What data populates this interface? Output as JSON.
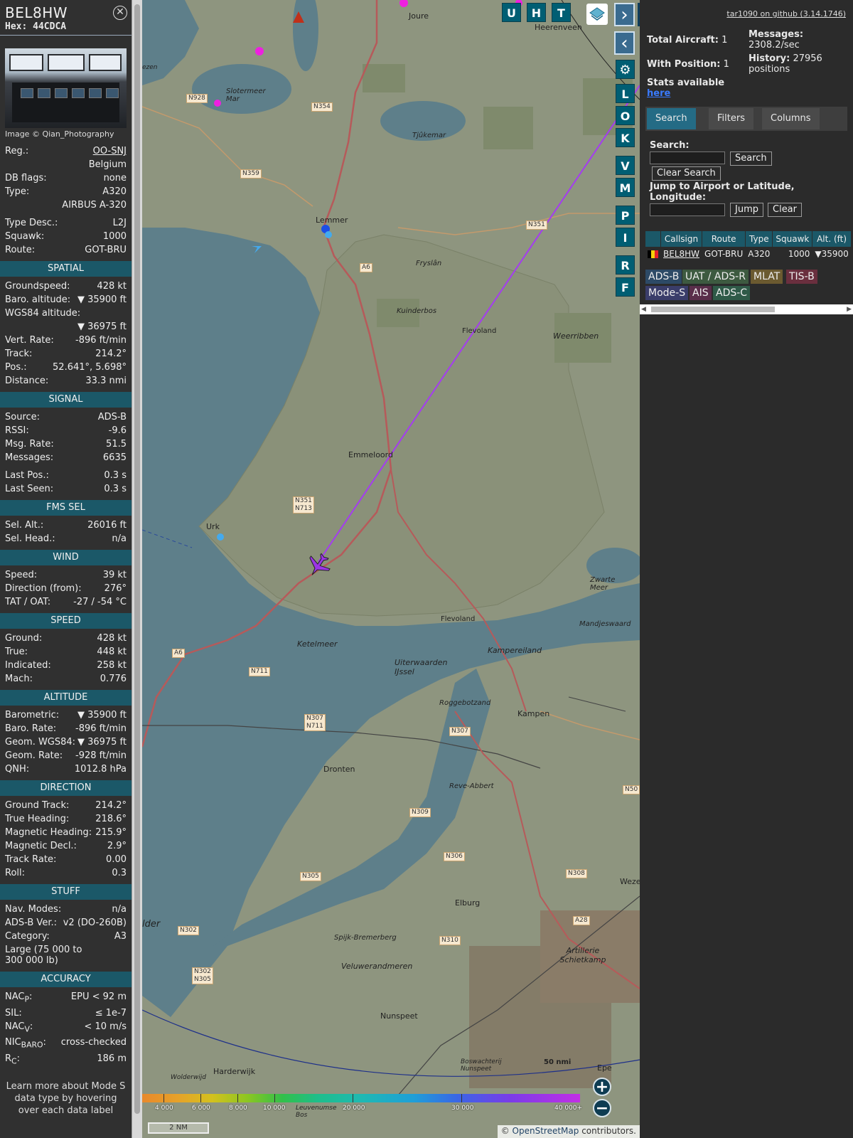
{
  "aircraft": {
    "callsign": "BEL8HW",
    "hex_label": "Hex:",
    "hex": "44CDCA",
    "image_credit": "Image © Qian_Photography",
    "reg_label": "Reg.:",
    "reg": "OO-SNJ",
    "country": "Belgium",
    "dbflags_label": "DB flags:",
    "dbflags": "none",
    "type_label": "Type:",
    "type": "A320",
    "type_full": "AIRBUS A-320",
    "typedesc_label": "Type Desc.:",
    "typedesc": "L2J",
    "squawk_label": "Squawk:",
    "squawk": "1000",
    "route_label": "Route:",
    "route": "GOT-BRU"
  },
  "spatial": {
    "title": "SPATIAL",
    "groundspeed_label": "Groundspeed:",
    "groundspeed": "428 kt",
    "baro_label": "Baro. altitude:",
    "baro": "▼ 35900 ft",
    "wgs_label": "WGS84 altitude:",
    "wgs": "▼ 36975 ft",
    "vrate_label": "Vert. Rate:",
    "vrate": "-896 ft/min",
    "track_label": "Track:",
    "track": "214.2°",
    "pos_label": "Pos.:",
    "pos": "52.641°, 5.698°",
    "dist_label": "Distance:",
    "dist": "33.3 nmi"
  },
  "signal": {
    "title": "SIGNAL",
    "source_label": "Source:",
    "source": "ADS-B",
    "rssi_label": "RSSI:",
    "rssi": "-9.6",
    "msgrate_label": "Msg. Rate:",
    "msgrate": "51.5",
    "messages_label": "Messages:",
    "messages": "6635",
    "lastpos_label": "Last Pos.:",
    "lastpos": "0.3 s",
    "lastseen_label": "Last Seen:",
    "lastseen": "0.3 s"
  },
  "fms": {
    "title": "FMS SEL",
    "selalt_label": "Sel. Alt.:",
    "selalt": "26016 ft",
    "selhead_label": "Sel. Head.:",
    "selhead": "n/a"
  },
  "wind": {
    "title": "WIND",
    "speed_label": "Speed:",
    "speed": "39 kt",
    "dir_label": "Direction (from):",
    "dir": "276°",
    "tat_label": "TAT / OAT:",
    "tat": "-27 / -54 °C"
  },
  "speed": {
    "title": "SPEED",
    "ground_label": "Ground:",
    "ground": "428 kt",
    "true_label": "True:",
    "true": "448 kt",
    "ind_label": "Indicated:",
    "ind": "258 kt",
    "mach_label": "Mach:",
    "mach": "0.776"
  },
  "altitude": {
    "title": "ALTITUDE",
    "baro_label": "Barometric:",
    "baro": "▼ 35900 ft",
    "bararate_label": "Baro. Rate:",
    "bararate": "-896 ft/min",
    "geom_label": "Geom. WGS84:",
    "geom": "▼ 36975 ft",
    "geomrate_label": "Geom. Rate:",
    "geomrate": "-928 ft/min",
    "qnh_label": "QNH:",
    "qnh": "1012.8 hPa"
  },
  "direction": {
    "title": "DIRECTION",
    "gtrack_label": "Ground Track:",
    "gtrack": "214.2°",
    "thead_label": "True Heading:",
    "thead": "218.6°",
    "mhead_label": "Magnetic Heading:",
    "mhead": "215.9°",
    "mdecl_label": "Magnetic Decl.:",
    "mdecl": "2.9°",
    "trate_label": "Track Rate:",
    "trate": "0.00",
    "roll_label": "Roll:",
    "roll": "0.3"
  },
  "stuff": {
    "title": "STUFF",
    "navmodes_label": "Nav. Modes:",
    "navmodes": "n/a",
    "adsbver_label": "ADS-B Ver.:",
    "adsbver": "v2 (DO-260B)",
    "category_label": "Category:",
    "category": "A3",
    "category_desc": "Large (75 000 to 300 000 lb)"
  },
  "accuracy": {
    "title": "ACCURACY",
    "nacp_label": "NAC",
    "nacp_sub": "P",
    "nacp": "EPU < 92 m",
    "sil_label": "SIL:",
    "sil": "≤ 1e-7",
    "nacv_label": "NAC",
    "nacv_sub": "V",
    "nacv": "< 10 m/s",
    "nicbaro_label": "NIC",
    "nicbaro_sub": "BARO",
    "nicbaro": "cross-checked",
    "rc_label": "R",
    "rc_sub": "C",
    "rc": "186 m"
  },
  "learn_more": "Learn more about Mode S data type by hovering over each data label",
  "map": {
    "buttons_top": [
      "U",
      "H",
      "T"
    ],
    "buttons_side": [
      "L",
      "O",
      "K",
      "V",
      "M",
      "P",
      "I",
      "R",
      "F"
    ],
    "color_scale": [
      "4 000",
      "6 000",
      "8 000",
      "10 000",
      "20 000",
      "30 000",
      "40 000+"
    ],
    "scale": "2 NM",
    "range_ring": "50 nmi",
    "attribution_prefix": "© ",
    "attribution_link": "OpenStreetMap",
    "attribution_suffix": " contributors.",
    "places": {
      "joure": "Joure",
      "heerenveen": "Heerenveen",
      "sloten": "Slotermeer Mar",
      "tjeuke": "Tjûkemar",
      "lemmer": "Lemmer",
      "fryslan": "Fryslân",
      "kuinderbos": "Kuinderbos",
      "flevoland": "Flevoland",
      "weerribben": "Weerribben",
      "emmeloord": "Emmeloord",
      "urk": "Urk",
      "zwarte": "Zwarte Meer",
      "flevoland2": "Flevoland",
      "mandjes": "Mandjeswaard",
      "ketelmeer": "Ketelmeer",
      "kampereiland": "Kampereiland",
      "uiterwaarden": "Uiterwaarden IJssel",
      "roggebot": "Roggebotzand",
      "kampen": "Kampen",
      "dronten": "Dronten",
      "reveabbert": "Reve-Abbert",
      "elburg": "Elburg",
      "spijk": "Spijk-Bremerberg",
      "artillerie": "Artillerie Schietkamp",
      "veluwerand": "Veluwerandmeren",
      "nunspeet": "Nunspeet",
      "harderwijk": "Harderwijk",
      "epe": "Epe",
      "wolderwijd": "Wolderwijd",
      "lder": "lder",
      "leuvenumse": "Leuvenumse Bos",
      "boswachterij": "Boswachterij Nunspeet",
      "weze": "Weze",
      "ezen": "ezen"
    },
    "roads": {
      "n928": "N928",
      "n354": "N354",
      "n359": "N359",
      "a6": "A6",
      "n351": "N351",
      "n351b": "N351",
      "n713": "N713",
      "a6b": "A6",
      "n711": "N711",
      "n307": "N307",
      "n711b": "N711",
      "n307b": "N307",
      "n309": "N309",
      "n306": "N306",
      "n305": "N305",
      "n302": "N302",
      "n302b": "N302",
      "n305b": "N305",
      "n310": "N310",
      "a28": "A28",
      "n308": "N308",
      "n50": "N50"
    }
  },
  "side": {
    "github": "tar1090 on github (3.14.1746)",
    "total_label": "Total Aircraft:",
    "total": "1",
    "withpos_label": "With Position:",
    "withpos": "1",
    "messages_label": "Messages:",
    "messages": "2308.2/sec",
    "history_label": "History:",
    "history": "27956 positions",
    "stats_label": "Stats available",
    "stats_link": "here",
    "tabs": [
      "Search",
      "Filters",
      "Columns"
    ],
    "search_label": "Search:",
    "search_button": "Search",
    "clear_search_button": "Clear Search",
    "jump_label": "Jump to Airport or Latitude, Longitude:",
    "jump_button": "Jump",
    "clear_button": "Clear",
    "table_headers": [
      "Callsign",
      "Route",
      "Type",
      "Squawk",
      "Alt. (ft)"
    ],
    "table_row": {
      "callsign": "BEL8HW",
      "route": "GOT-BRU",
      "type": "A320",
      "squawk": "1000",
      "alt": "▼35900"
    },
    "source_chips": [
      "ADS-B",
      "UAT / ADS-R",
      "MLAT",
      "TIS-B",
      "Mode-S",
      "AIS",
      "ADS-C"
    ],
    "chip_colors": [
      "#2d4a66",
      "#3d5a40",
      "#6b5a30",
      "#6a2f3e",
      "#3a3d6a",
      "#5a2e4a",
      "#2f5a48"
    ]
  }
}
